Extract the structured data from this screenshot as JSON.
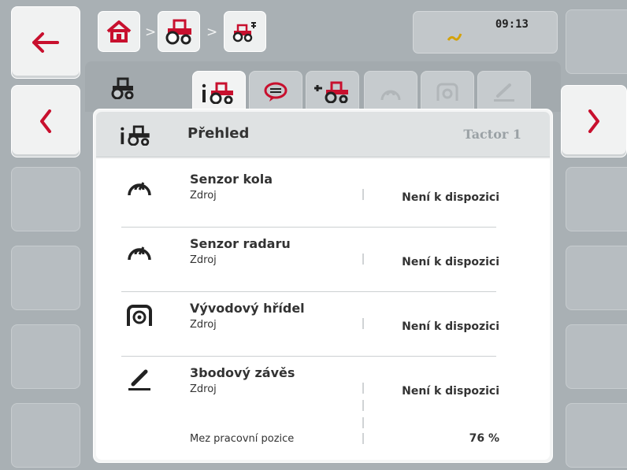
{
  "left_softkeys": [
    {
      "icon": "arrow-left-icon",
      "label": ""
    },
    {
      "icon": "chevron-left-icon",
      "label": ""
    }
  ],
  "right_softkeys": [
    {
      "icon": "chevron-right-icon",
      "label": ""
    }
  ],
  "breadcrumb": [
    "home-icon",
    "tractor-icon",
    "tractor-settings-icon"
  ],
  "status": {
    "time": "09:13",
    "icon": "gps-signal-icon"
  },
  "tabs": [
    {
      "icon": "tractor-icon",
      "active": false
    },
    {
      "icon": "tractor-info-icon",
      "active": true
    },
    {
      "icon": "speech-bubble-icon",
      "active": false
    },
    {
      "icon": "tractor-settings-icon",
      "active": false
    },
    {
      "icon": "wheel-sensor-icon",
      "active": false,
      "dimmed": true
    },
    {
      "icon": "pto-icon",
      "active": false,
      "dimmed": true
    },
    {
      "icon": "hitch-icon",
      "active": false,
      "dimmed": true
    }
  ],
  "header": {
    "title": "Přehled",
    "tractor_name": "Tactor 1"
  },
  "items": [
    {
      "icon": "wheel-sensor-icon",
      "name": "Senzor kola",
      "sub": "Zdroj",
      "value": "Není k dispozici"
    },
    {
      "icon": "radar-sensor-icon",
      "name": "Senzor radaru",
      "sub": "Zdroj",
      "value": "Není k dispozici"
    },
    {
      "icon": "pto-icon",
      "name": "Vývodový hřídel",
      "sub": "Zdroj",
      "value": "Není k dispozici"
    },
    {
      "icon": "hitch-icon",
      "name": "3bodový závěs",
      "sub": "Zdroj",
      "value": "Není k dispozici",
      "extra_sub": "Mez pracovní pozice",
      "extra_value": "76 %"
    }
  ],
  "colors": {
    "accent": "#c8102e",
    "background": "#a9b0b4"
  }
}
